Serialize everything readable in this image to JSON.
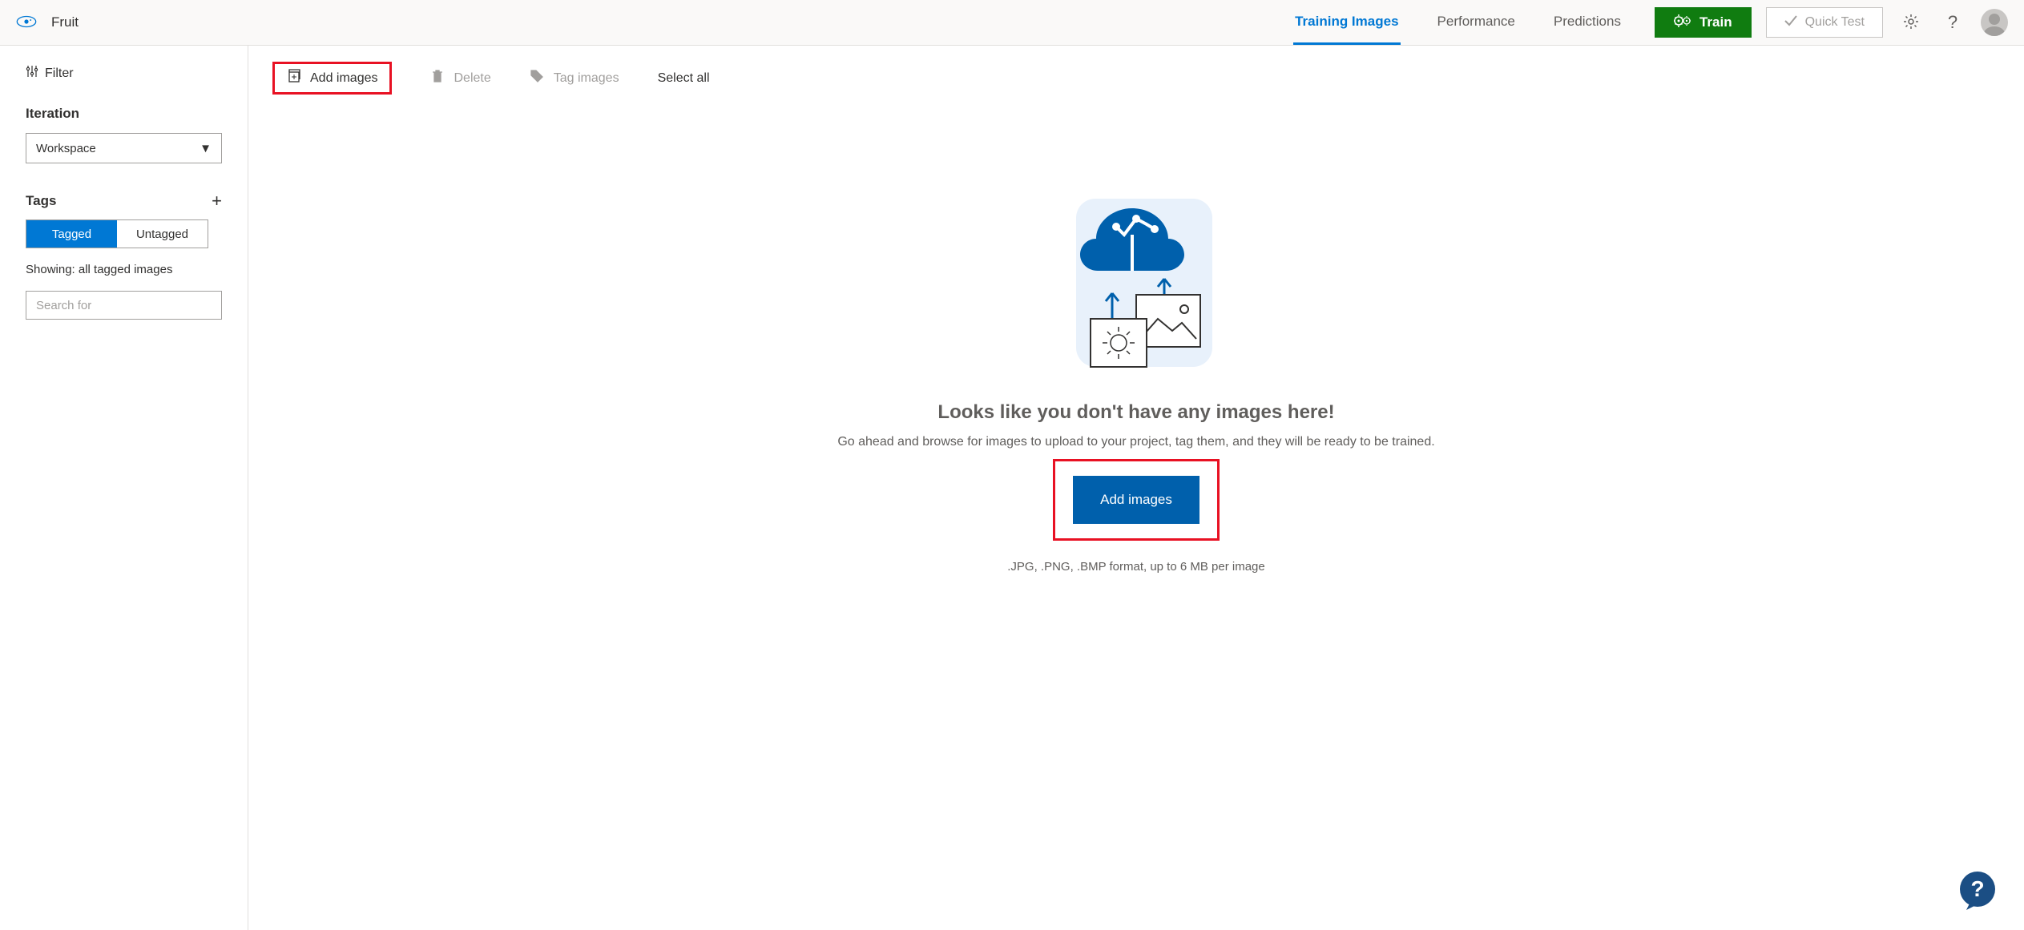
{
  "header": {
    "project_name": "Fruit",
    "tabs": {
      "training_images": "Training Images",
      "performance": "Performance",
      "predictions": "Predictions"
    },
    "train_button": "Train",
    "quick_test_button": "Quick Test"
  },
  "sidebar": {
    "filter_label": "Filter",
    "iteration_label": "Iteration",
    "iteration_selected": "Workspace",
    "tags_label": "Tags",
    "toggle_tagged": "Tagged",
    "toggle_untagged": "Untagged",
    "showing_text": "Showing: all tagged images",
    "search_placeholder": "Search for"
  },
  "toolbar": {
    "add_images": "Add images",
    "delete": "Delete",
    "tag_images": "Tag images",
    "select_all": "Select all"
  },
  "empty": {
    "title": "Looks like you don't have any images here!",
    "description": "Go ahead and browse for images to upload to your project, tag them, and they will be ready to be trained.",
    "add_button": "Add images",
    "hint": ".JPG, .PNG, .BMP format, up to 6 MB per image"
  }
}
